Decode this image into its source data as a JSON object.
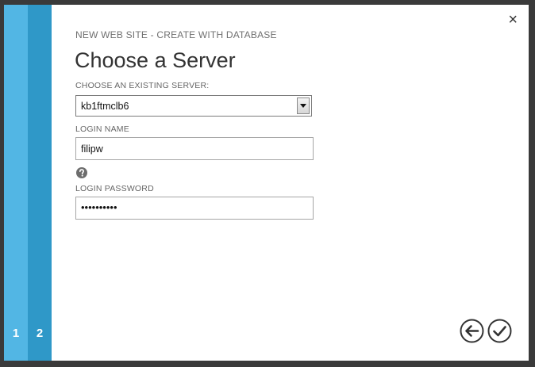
{
  "steps": [
    "1",
    "2"
  ],
  "dialog": {
    "subtitle": "NEW WEB SITE - CREATE WITH DATABASE",
    "title": "Choose a Server",
    "close_glyph": "×"
  },
  "form": {
    "server_label": "CHOOSE AN EXISTING SERVER:",
    "server_value": "kb1ftmclb6",
    "login_label": "LOGIN NAME",
    "login_value": "filipw",
    "password_label": "LOGIN PASSWORD",
    "password_value": "••••••••••"
  },
  "icons": {
    "help": "question-circle-icon",
    "back": "back-arrow-icon",
    "complete": "checkmark-icon",
    "close": "close-icon",
    "dropdown": "dropdown-arrow-icon"
  },
  "colors": {
    "step1": "#52b6e4",
    "step2": "#2f98c8",
    "frame": "#3a3a3a"
  }
}
